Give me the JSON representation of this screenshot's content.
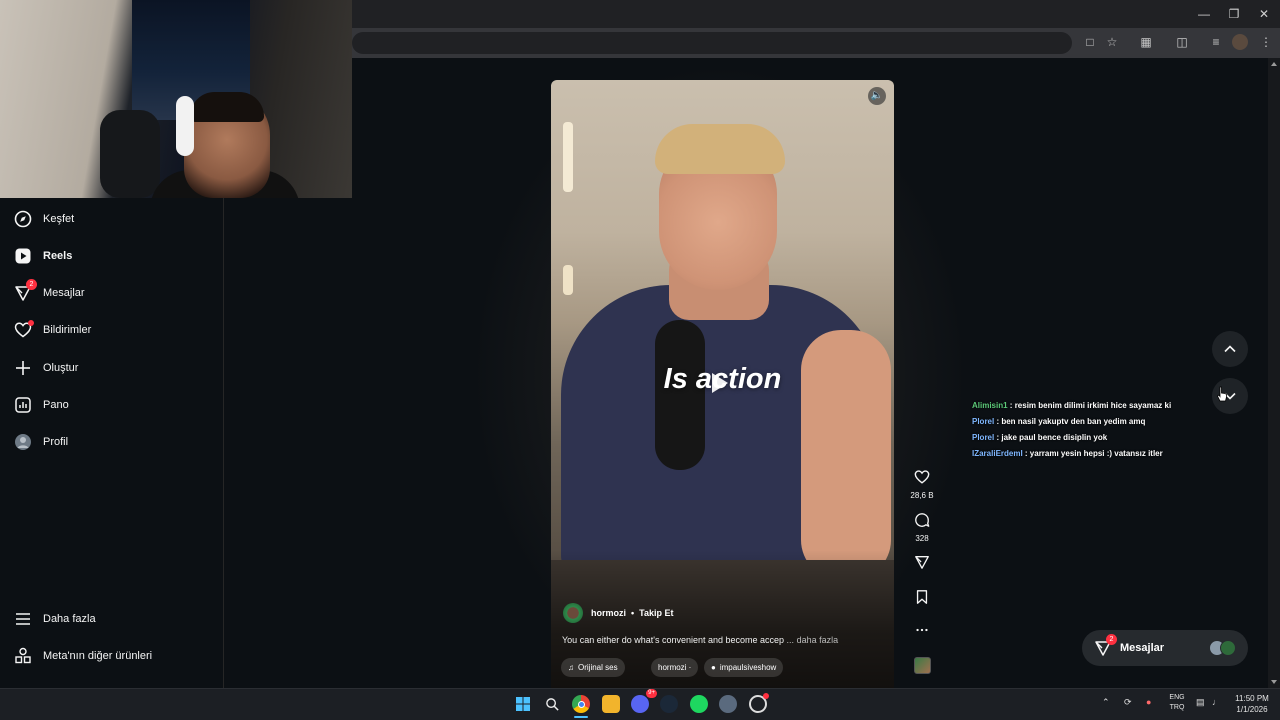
{
  "sidebar": {
    "items": [
      {
        "label": "Keşfet",
        "icon": "compass-icon"
      },
      {
        "label": "Reels",
        "icon": "reels-icon"
      },
      {
        "label": "Mesajlar",
        "icon": "messenger-icon",
        "badge": "2"
      },
      {
        "label": "Bildirimler",
        "icon": "heart-icon"
      },
      {
        "label": "Oluştur",
        "icon": "plus-icon"
      },
      {
        "label": "Pano",
        "icon": "dashboard-icon"
      },
      {
        "label": "Profil",
        "icon": "avatar"
      }
    ],
    "footer": [
      {
        "label": "Daha fazla",
        "icon": "hamburger-icon"
      },
      {
        "label": "Meta'nın diğer ürünleri",
        "icon": "apps-icon"
      }
    ]
  },
  "reel": {
    "caption": "Is action",
    "author": "hormozi",
    "separator": "•",
    "follow_label": "Takip Et",
    "description": "You can either do what's convenient and become accep",
    "ellipsis": " ... ",
    "more_label": "daha fazla",
    "audio_label": "Orijinal ses",
    "audio_author": "hormozi ·",
    "collab_label": "impaulsiveshow"
  },
  "actions": {
    "likes": "28,6 B",
    "comments": "328"
  },
  "chat": [
    {
      "user": "Alimisin1",
      "text": " : resim benim dilimi irkimi hice sayamaz ki",
      "color": "green"
    },
    {
      "user": "Plorel",
      "text": " : ben nasil yakuptv den ban yedim amq",
      "color": "green"
    },
    {
      "user": "Plorel",
      "text": " : jake paul bence disiplin yok",
      "color": "green"
    },
    {
      "user": "IZaraliErdemI",
      "text": " : yarramı yesin hepsi :) vatansız itler",
      "color": "blue"
    }
  ],
  "messages_bubble": {
    "label": "Mesajlar",
    "badge": "2"
  },
  "taskbar": {
    "lang_top": "ENG",
    "lang_bottom": "TRQ",
    "time": "11:50 PM",
    "date": "1/1/2026",
    "discord_badge": "9+"
  },
  "colors": {
    "background": "#0c1014",
    "badge": "#ff3040",
    "chat_user_green": "#5cc979",
    "chat_user_blue": "#7fb7ff"
  }
}
